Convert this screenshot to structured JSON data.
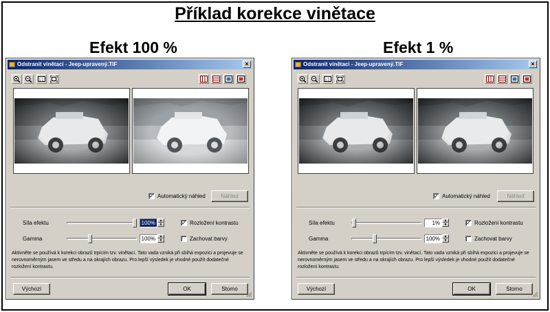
{
  "page_title": "Příklad korekce vinětace",
  "panels": [
    {
      "heading": "Efekt 100 %",
      "dialog_title": "Odstranit vinětaci - Jeep-upravený.TIF",
      "auto_preview_label": "Automatický náhled",
      "auto_preview_checked": true,
      "preview_button": "Náhled",
      "effect_label": "Síla efektu",
      "effect_value": "100%",
      "effect_value_selected": true,
      "effect_level": 1.0,
      "gamma_label": "Gamma",
      "gamma_value": "100%",
      "gamma_level": 0.32,
      "contrast_label": "Rozložení kontrastu",
      "contrast_checked": true,
      "keep_colors_label": "Zachovat barvy",
      "keep_colors_checked": false,
      "description": "Aktivněte se používá k korekci obrazů trpícím tzv. vinětací. Tato vada vzniká při sbíhá expozici a projevuje se nerovnoměrným jasem ve středu a na okrajích obrazu. Pro lepší výsledek je vhodné použít dodatečné rozložení kontrastu.",
      "defaults_button": "Výchozí",
      "ok_button": "OK",
      "cancel_button": "Storno"
    },
    {
      "heading": "Efekt 1 %",
      "dialog_title": "Odstranit vinětaci - Jeep-upravený.TIF",
      "auto_preview_label": "Automatický náhled",
      "auto_preview_checked": true,
      "preview_button": "Náhled",
      "effect_label": "Síla efektu",
      "effect_value": "1%",
      "effect_value_selected": false,
      "effect_level": 0.01,
      "gamma_label": "Gamma",
      "gamma_value": "100%",
      "gamma_level": 0.32,
      "contrast_label": "Rozložení kontrastu",
      "contrast_checked": true,
      "keep_colors_label": "Zachovat barvy",
      "keep_colors_checked": false,
      "description": "Aktivněte se používá k korekci obrazů trpícím tzv. vinětací. Tato vada vzniká při sbíhá expozici a projevuje se nerovnoměrným jasem ve středu a na okrajích obrazu. Pro lepší výsledek je vhodné použít dodatečné rozložení kontrastu.",
      "defaults_button": "Výchozí",
      "ok_button": "OK",
      "cancel_button": "Storno"
    }
  ],
  "toolbar_icons": [
    "zoom-in-icon",
    "zoom-out-icon",
    "actual-size-icon",
    "fit-window-icon"
  ],
  "view_icons": [
    "split-vertical-icon",
    "split-horizontal-icon",
    "single-view-icon",
    "original-view-icon"
  ],
  "colors": {
    "dialog_face": "#d4d0c8",
    "titlebar_start": "#0a246a",
    "titlebar_end": "#a6caf0"
  }
}
